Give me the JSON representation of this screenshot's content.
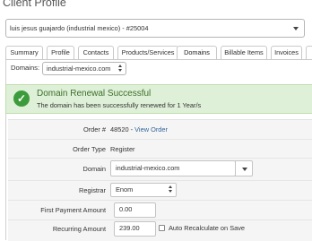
{
  "page": {
    "title": "Client Profile"
  },
  "client_selector": {
    "value": "luis jesus guajardo (industrial mexico) - #25004"
  },
  "tabs": [
    {
      "label": "Summary"
    },
    {
      "label": "Profile"
    },
    {
      "label": "Contacts"
    },
    {
      "label": "Products/Services"
    },
    {
      "label": "Domains",
      "active": true
    },
    {
      "label": "Billable Items"
    },
    {
      "label": "Invoices"
    },
    {
      "label": "Q"
    }
  ],
  "domain_filter": {
    "label": "Domains:",
    "value": "industrial-mexico.com"
  },
  "alert": {
    "title": "Domain Renewal Successful",
    "message": "The domain has been successfully renewed for 1 Year/s",
    "color": "#dff0d8"
  },
  "form": {
    "order": {
      "label": "Order #",
      "id": "48520",
      "sep": " - ",
      "link": "View Order"
    },
    "order_type": {
      "label": "Order Type",
      "value": "Register"
    },
    "domain": {
      "label": "Domain",
      "value": "industrial-mexico.com"
    },
    "registrar": {
      "label": "Registrar",
      "value": "Enom"
    },
    "first_payment": {
      "label": "First Payment Amount",
      "value": "0.00"
    },
    "recurring": {
      "label": "Recurring Amount",
      "value": "239.00",
      "auto_recalc_label": "Auto Recalculate on Save",
      "auto_recalc_checked": false
    }
  }
}
